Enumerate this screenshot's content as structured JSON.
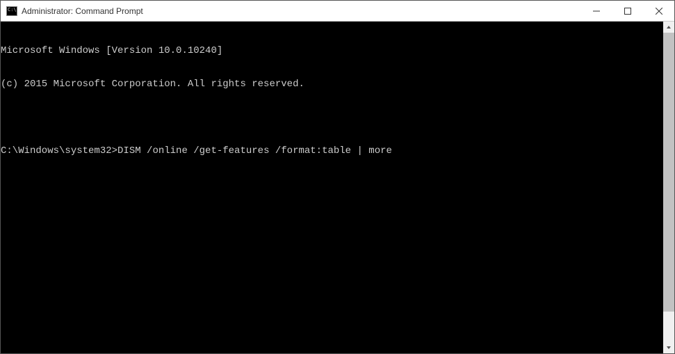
{
  "titlebar": {
    "title": "Administrator: Command Prompt"
  },
  "console": {
    "line1": "Microsoft Windows [Version 10.0.10240]",
    "line2": "(c) 2015 Microsoft Corporation. All rights reserved.",
    "blank": "",
    "prompt": "C:\\Windows\\system32>",
    "command": "DISM /online /get-features /format:table | more"
  }
}
